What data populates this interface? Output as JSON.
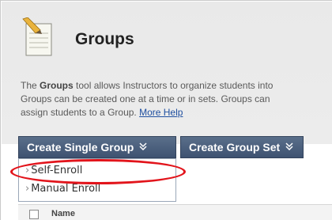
{
  "page": {
    "title": "Groups",
    "description_prefix": "The ",
    "description_bold": "Groups",
    "description_rest": " tool allows Instructors to organize students into",
    "description_line2": "Groups can be created one at a time or in sets. Groups can",
    "description_line3": "assign students to a Group. ",
    "more_help": "More Help"
  },
  "toolbar": {
    "create_single_group": "Create Single Group",
    "create_group_set": "Create Group Set",
    "chevron": "≈"
  },
  "dropdown": {
    "items": [
      {
        "label": "Self-Enroll",
        "caret": "›"
      },
      {
        "label": "Manual Enroll",
        "caret": "›"
      }
    ]
  },
  "grid": {
    "column_name": "Name"
  },
  "colors": {
    "button_bg": "#4a5f7e",
    "highlight": "#e2141b",
    "link": "#1f4fa0"
  },
  "icons": {
    "tool_icon": "notepad-pencil-icon",
    "chevron_icon": "double-chevron-down-icon",
    "caret_icon": "caret-right-icon"
  }
}
